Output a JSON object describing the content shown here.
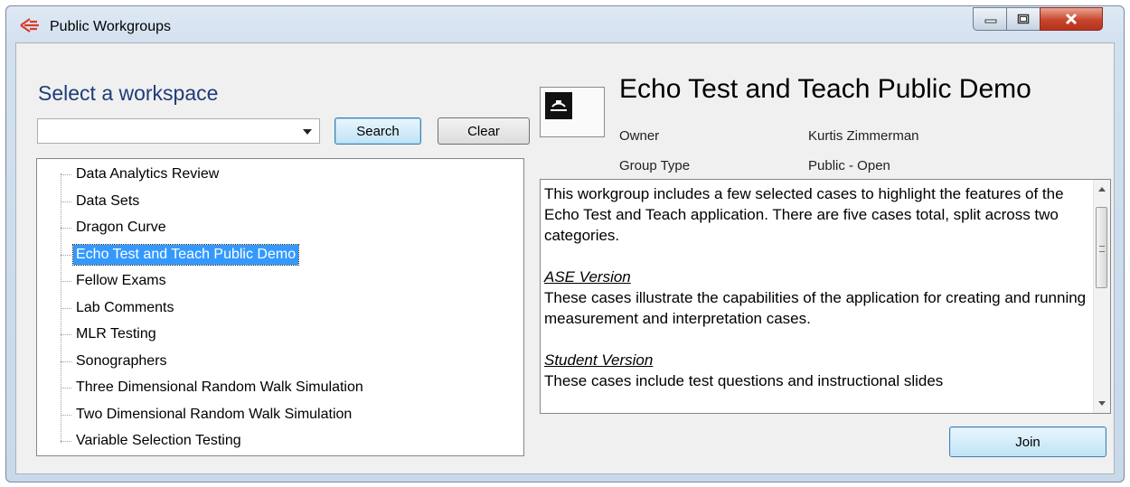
{
  "window": {
    "title": "Public Workgroups"
  },
  "left": {
    "heading": "Select a workspace",
    "search_value": "",
    "search_label": "Search",
    "clear_label": "Clear",
    "tree_items": [
      {
        "label": "Data Analytics Review",
        "selected": false
      },
      {
        "label": "Data Sets",
        "selected": false
      },
      {
        "label": "Dragon Curve",
        "selected": false
      },
      {
        "label": "Echo Test and Teach Public Demo",
        "selected": true
      },
      {
        "label": "Fellow Exams",
        "selected": false
      },
      {
        "label": "Lab Comments",
        "selected": false
      },
      {
        "label": "MLR Testing",
        "selected": false
      },
      {
        "label": "Sonographers",
        "selected": false
      },
      {
        "label": "Three Dimensional Random Walk Simulation",
        "selected": false
      },
      {
        "label": "Two Dimensional Random Walk Simulation",
        "selected": false
      },
      {
        "label": "Variable Selection Testing",
        "selected": false
      }
    ]
  },
  "detail": {
    "title": "Echo Test and Teach Public Demo",
    "owner_label": "Owner",
    "owner_value": "Kurtis Zimmerman",
    "group_type_label": "Group Type",
    "group_type_value": "Public - Open",
    "description": {
      "intro": "This workgroup includes a few selected cases to highlight the features of the Echo Test and Teach application. There are five cases total, split across two categories.",
      "section1_title": "ASE Version",
      "section1_text": "These cases illustrate the capabilities of the application for creating and running measurement and interpretation cases.",
      "section2_title": "Student Version",
      "section2_text": "These cases include test questions and instructional slides"
    },
    "join_label": "Join"
  },
  "colors": {
    "heading": "#1e3c78",
    "selection": "#3399ff",
    "close_button": "#c9452c"
  }
}
